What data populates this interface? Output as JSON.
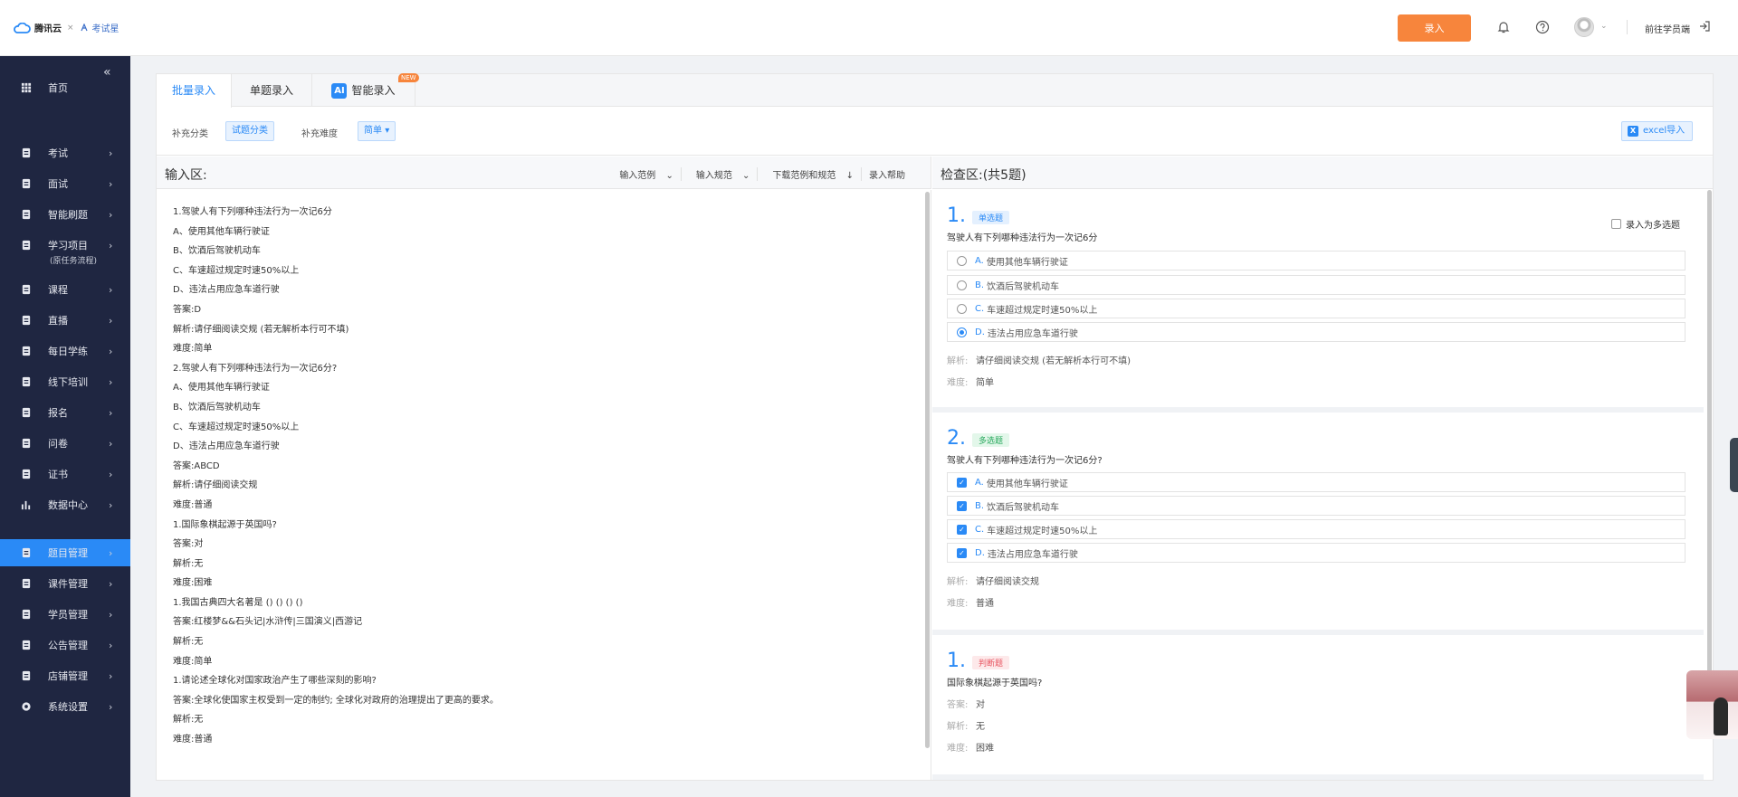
{
  "header": {
    "logo_brand": "腾讯云",
    "logo_times": "×",
    "logo_product": "考试星",
    "enroll_button": "录入",
    "goto_student": "前往学员端"
  },
  "sidebar": {
    "items": [
      {
        "label": "首页",
        "icon": "grid-icon"
      },
      {
        "label": "考试",
        "icon": "clipboard-check-icon"
      },
      {
        "label": "面试",
        "icon": "clipboard-icon"
      },
      {
        "label": "智能刷题",
        "icon": "medal-icon"
      },
      {
        "label": "学习项目",
        "sub": "(原任务流程)",
        "icon": "project-icon"
      },
      {
        "label": "课程",
        "icon": "book-icon"
      },
      {
        "label": "直播",
        "icon": "live-icon"
      },
      {
        "label": "每日学练",
        "icon": "calendar-check-icon"
      },
      {
        "label": "线下培训",
        "icon": "training-icon"
      },
      {
        "label": "报名",
        "icon": "signup-icon"
      },
      {
        "label": "问卷",
        "icon": "survey-icon"
      },
      {
        "label": "证书",
        "icon": "certificate-icon"
      },
      {
        "label": "数据中心",
        "icon": "bar-chart-icon"
      },
      {
        "label": "题目管理",
        "icon": "question-bank-icon",
        "active": true
      },
      {
        "label": "课件管理",
        "icon": "folder-icon"
      },
      {
        "label": "学员管理",
        "icon": "user-card-icon"
      },
      {
        "label": "公告管理",
        "icon": "announcement-icon"
      },
      {
        "label": "店铺管理",
        "icon": "shop-icon"
      },
      {
        "label": "系统设置",
        "icon": "gear-icon"
      }
    ]
  },
  "tabs": [
    {
      "label": "批量录入",
      "active": true
    },
    {
      "label": "单题录入"
    },
    {
      "label": "智能录入",
      "badge": "NEW",
      "ai": "AI"
    }
  ],
  "filters": {
    "category_label": "补充分类",
    "category_value": "试题分类",
    "difficulty_label": "补充难度",
    "difficulty_value": "简单",
    "excel_button": "excel导入"
  },
  "input_panel": {
    "title": "输入区:",
    "links": [
      "输入范例",
      "输入规范",
      "下载范例和规范",
      "录入帮助"
    ],
    "lines": [
      "1.驾驶人有下列哪种违法行为一次记6分",
      "A、使用其他车辆行驶证",
      "B、饮酒后驾驶机动车",
      "C、车速超过规定时速50%以上",
      "D、违法占用应急车道行驶",
      "答案:D",
      "解析:请仔细阅读交规 (若无解析本行可不填)",
      "难度:简单",
      "2.驾驶人有下列哪种违法行为一次记6分?",
      "A、使用其他车辆行驶证",
      "B、饮酒后驾驶机动车",
      "C、车速超过规定时速50%以上",
      "D、违法占用应急车道行驶",
      "答案:ABCD",
      "解析:请仔细阅读交规",
      "难度:普通",
      "1.国际象棋起源于英国吗?",
      "答案:对",
      "解析:无",
      "难度:困难",
      "1.我国古典四大名著是 () () () ()",
      "答案:红楼梦&&石头记|水浒传|三国演义|西游记",
      "解析:无",
      "难度:简单",
      "1.请论述全球化对国家政治产生了哪些深刻的影响?",
      "答案:全球化使国家主权受到一定的制约; 全球化对政府的治理提出了更高的要求。",
      "解析:无",
      "难度:普通"
    ]
  },
  "check_panel": {
    "title": "检查区:(共5题)",
    "multi_toggle_label": "录入为多选题",
    "analysis_key": "解析:",
    "difficulty_key": "难度:",
    "answer_key": "答案:",
    "questions": [
      {
        "num": "1.",
        "type": "单选题",
        "stem": "驾驶人有下列哪种违法行为一次记6分",
        "options": [
          {
            "key": "A.",
            "text": "使用其他车辆行驶证",
            "selected": false
          },
          {
            "key": "B.",
            "text": "饮酒后驾驶机动车",
            "selected": false
          },
          {
            "key": "C.",
            "text": "车速超过规定时速50%以上",
            "selected": false
          },
          {
            "key": "D.",
            "text": "违法占用应急车道行驶",
            "selected": true
          }
        ],
        "analysis": "请仔细阅读交规 (若无解析本行可不填)",
        "difficulty": "简单"
      },
      {
        "num": "2.",
        "type": "多选题",
        "stem": "驾驶人有下列哪种违法行为一次记6分?",
        "options": [
          {
            "key": "A.",
            "text": "使用其他车辆行驶证",
            "selected": true
          },
          {
            "key": "B.",
            "text": "饮酒后驾驶机动车",
            "selected": true
          },
          {
            "key": "C.",
            "text": "车速超过规定时速50%以上",
            "selected": true
          },
          {
            "key": "D.",
            "text": "违法占用应急车道行驶",
            "selected": true
          }
        ],
        "analysis": "请仔细阅读交规",
        "difficulty": "普通"
      },
      {
        "num": "1.",
        "type": "判断题",
        "stem": "国际象棋起源于英国吗?",
        "answer": "对",
        "analysis": "无",
        "difficulty": "困难"
      }
    ]
  },
  "colors": {
    "primary": "#2a8af6",
    "orange": "#f7853c",
    "sidebar_bg": "#1f2641"
  }
}
